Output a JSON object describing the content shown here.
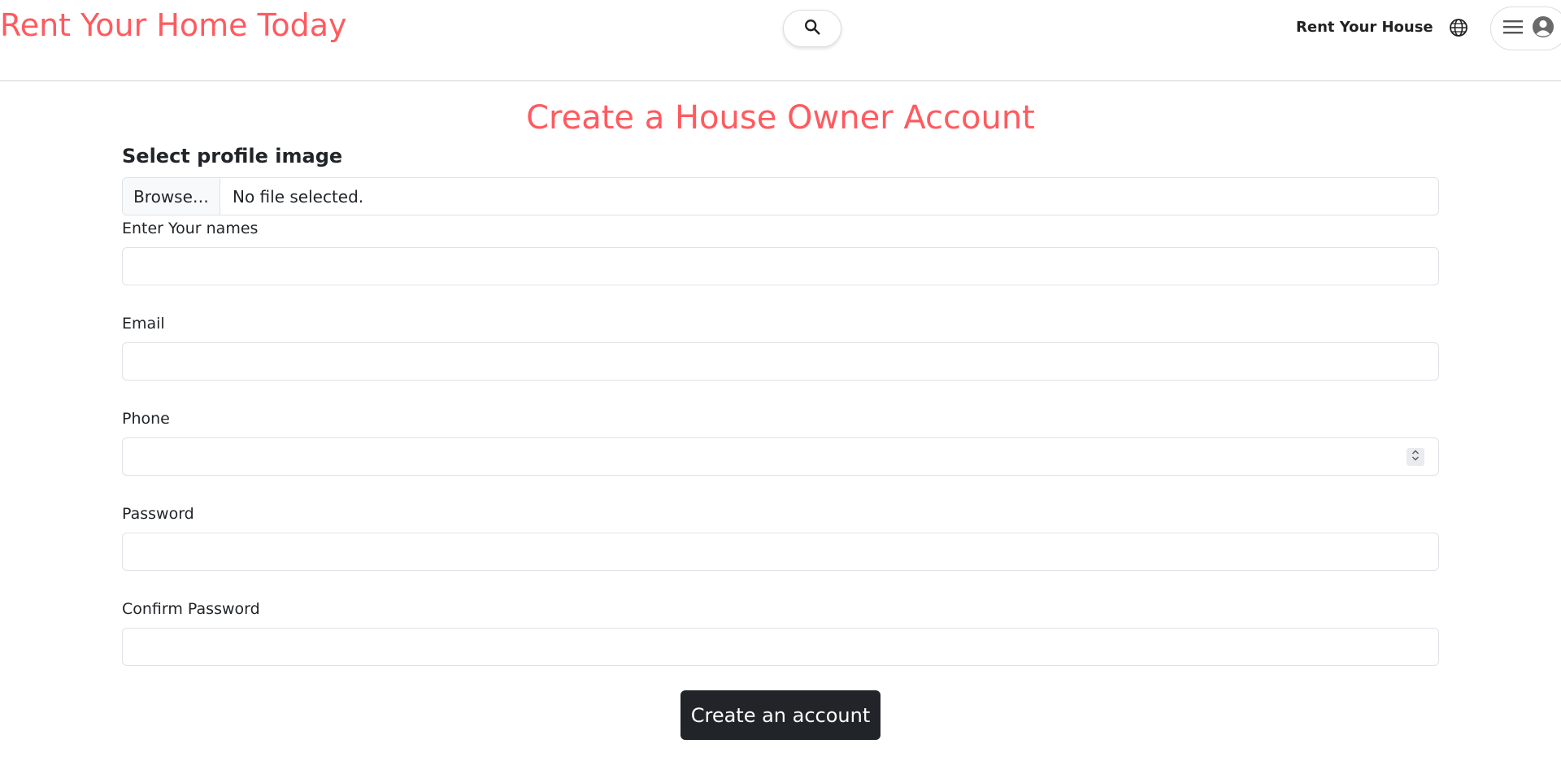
{
  "header": {
    "brand": "Rent Your Home Today",
    "rent_link": "Rent Your House",
    "icons": {
      "search": "search-icon",
      "globe": "globe-icon",
      "menu": "hamburger-icon",
      "user": "user-avatar-icon"
    }
  },
  "page": {
    "title": "Create a House Owner Account"
  },
  "form": {
    "profile_label": "Select profile image",
    "file_button": "Browse…",
    "file_status": "No file selected.",
    "names_label": "Enter Your names",
    "names_value": "",
    "email_label": "Email",
    "email_value": "",
    "phone_label": "Phone",
    "phone_value": "",
    "password_label": "Password",
    "password_value": "",
    "confirm_label": "Confirm Password",
    "confirm_value": "",
    "submit_label": "Create an account"
  },
  "colors": {
    "accent": "#ff5a5f",
    "button_dark": "#212529",
    "border": "#dee2e6"
  }
}
